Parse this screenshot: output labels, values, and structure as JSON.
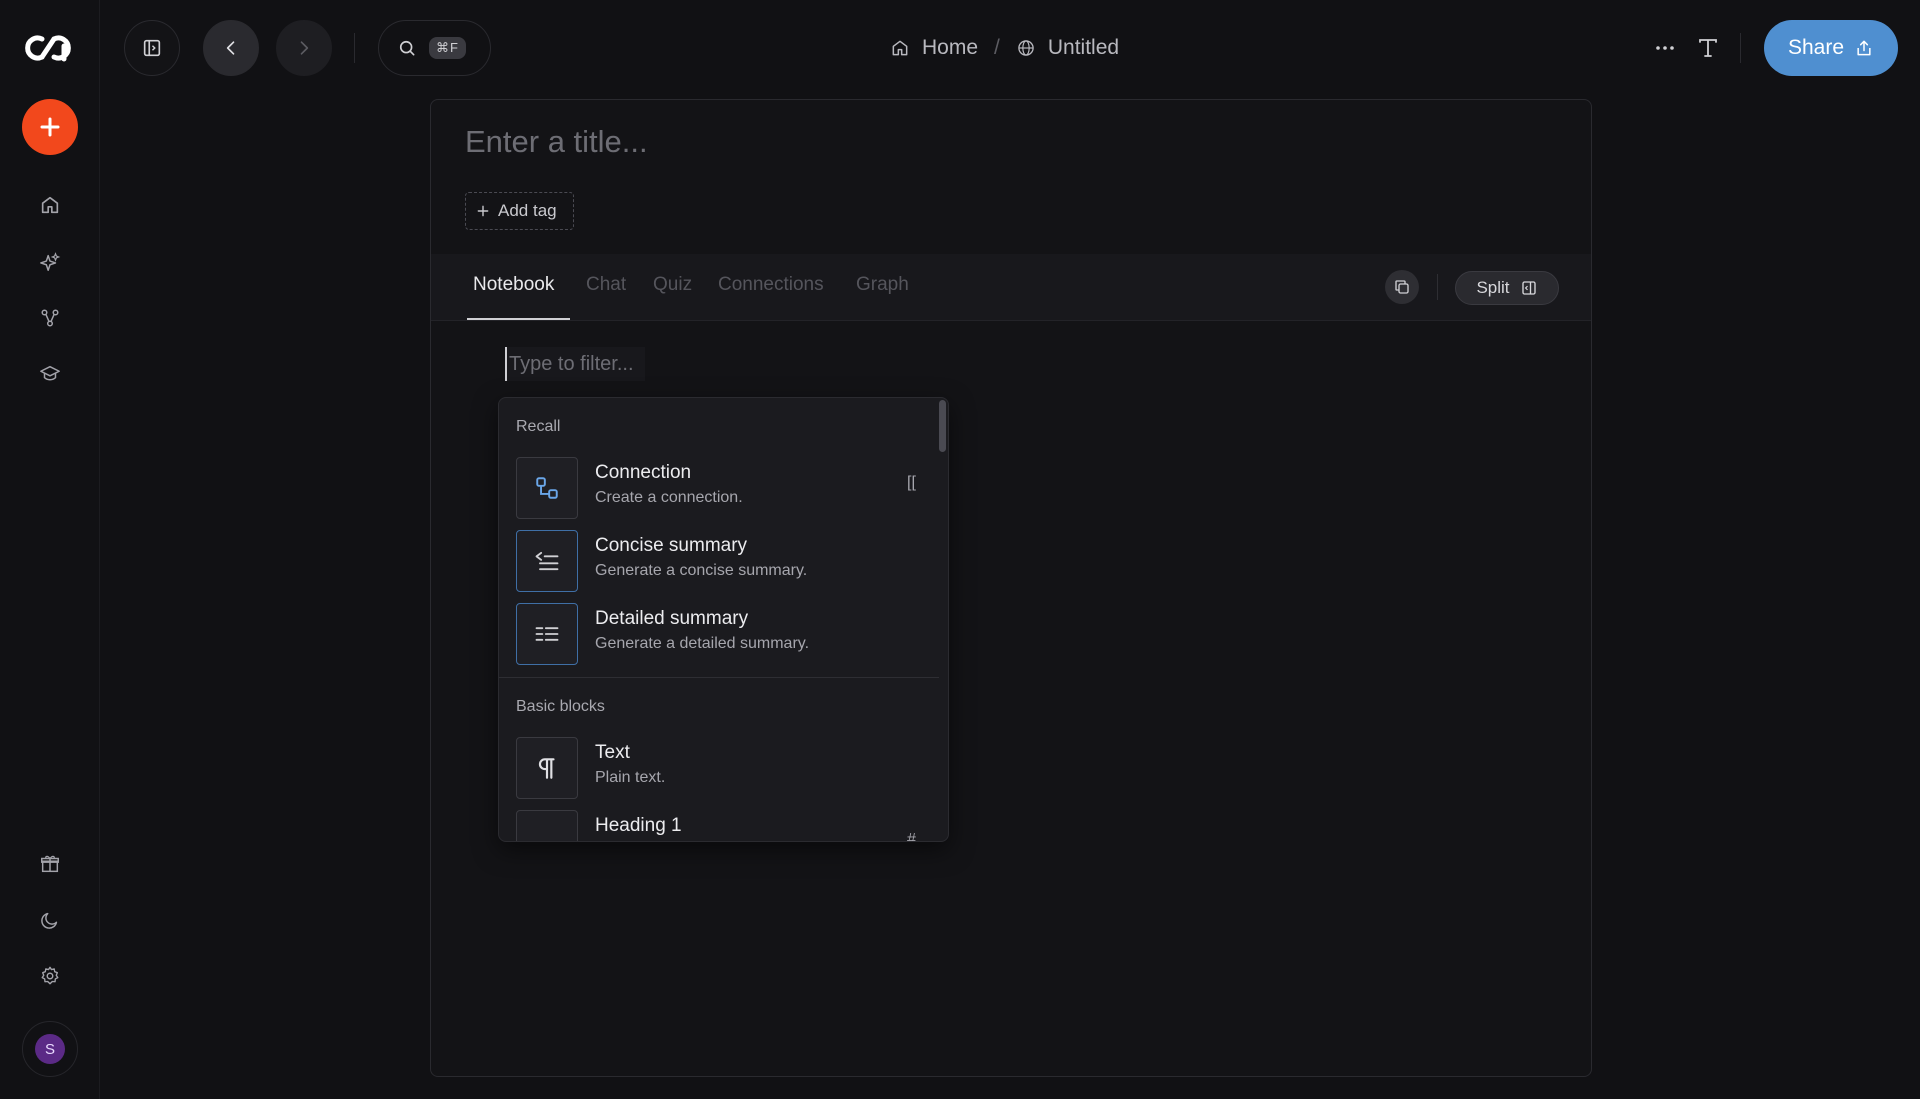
{
  "header": {
    "kbd_shortcut": "⌘F",
    "breadcrumb": {
      "home": "Home",
      "separator": "/",
      "current": "Untitled"
    },
    "share_label": "Share"
  },
  "user": {
    "avatar_initial": "S"
  },
  "editor": {
    "title_placeholder": "Enter a title...",
    "add_tag_label": "Add tag",
    "tabs": [
      "Notebook",
      "Chat",
      "Quiz",
      "Connections",
      "Graph"
    ],
    "active_tab": "Notebook",
    "split_label": "Split",
    "filter_placeholder": "Type to filter..."
  },
  "menu": {
    "sections": [
      {
        "label": "Recall",
        "items": [
          {
            "title": "Connection",
            "description": "Create a connection.",
            "shortcut": "[[",
            "icon": "connection-icon"
          },
          {
            "title": "Concise summary",
            "description": "Generate a concise summary.",
            "icon": "concise-summary-icon"
          },
          {
            "title": "Detailed summary",
            "description": "Generate a detailed summary.",
            "icon": "detailed-summary-icon"
          }
        ]
      },
      {
        "label": "Basic blocks",
        "items": [
          {
            "title": "Text",
            "description": "Plain text.",
            "icon": "pilcrow-icon"
          },
          {
            "title": "Heading 1",
            "description": "",
            "shortcut": "#",
            "icon": "heading-1-icon"
          }
        ]
      }
    ]
  },
  "colors": {
    "accent_orange": "#f2481c",
    "share_blue": "#4f8fd0",
    "selected_border": "#3f6fa6"
  }
}
